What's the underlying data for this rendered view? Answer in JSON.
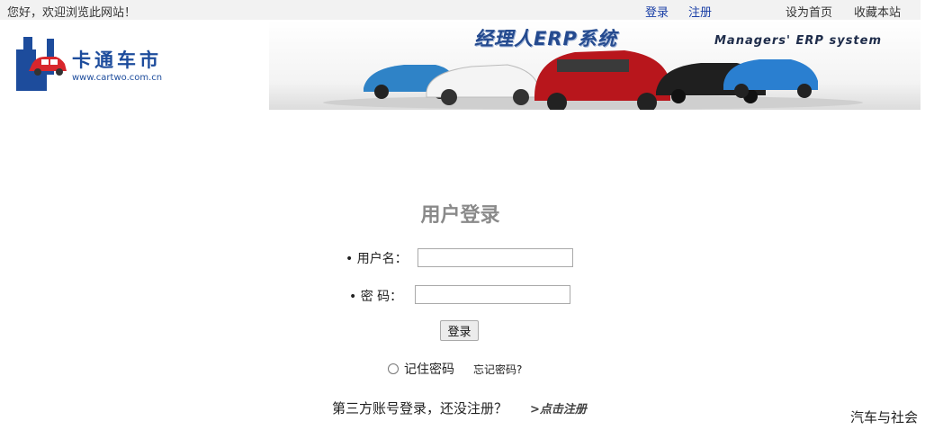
{
  "topbar": {
    "welcome": "您好，欢迎浏览此网站！",
    "login": "登录",
    "register": "注册",
    "set_homepage": "设为首页",
    "favorite": "收藏本站"
  },
  "logo": {
    "name": "卡通车市",
    "url": "www.cartwo.com.cn",
    "icon": "car-logo-icon"
  },
  "banner": {
    "title": "经理人ERP系统",
    "subtitle": "Managers' ERP system"
  },
  "login": {
    "title": "用户登录",
    "username_label": "• 用户名：",
    "username_value": "",
    "password_label": "• 密 码：",
    "password_value": "",
    "submit": "登录",
    "remember": "记住密码",
    "forgot": "忘记密码?",
    "third_party": "第三方账号登录，还没注册？",
    "click_register": ">点击注册"
  },
  "footer": {
    "link": "汽车与社会"
  },
  "colors": {
    "link_blue": "#1a3fa6",
    "brand_blue": "#1d4c9c",
    "title_gray": "#8a8a8a",
    "topbar_bg": "#f2f2f2"
  }
}
